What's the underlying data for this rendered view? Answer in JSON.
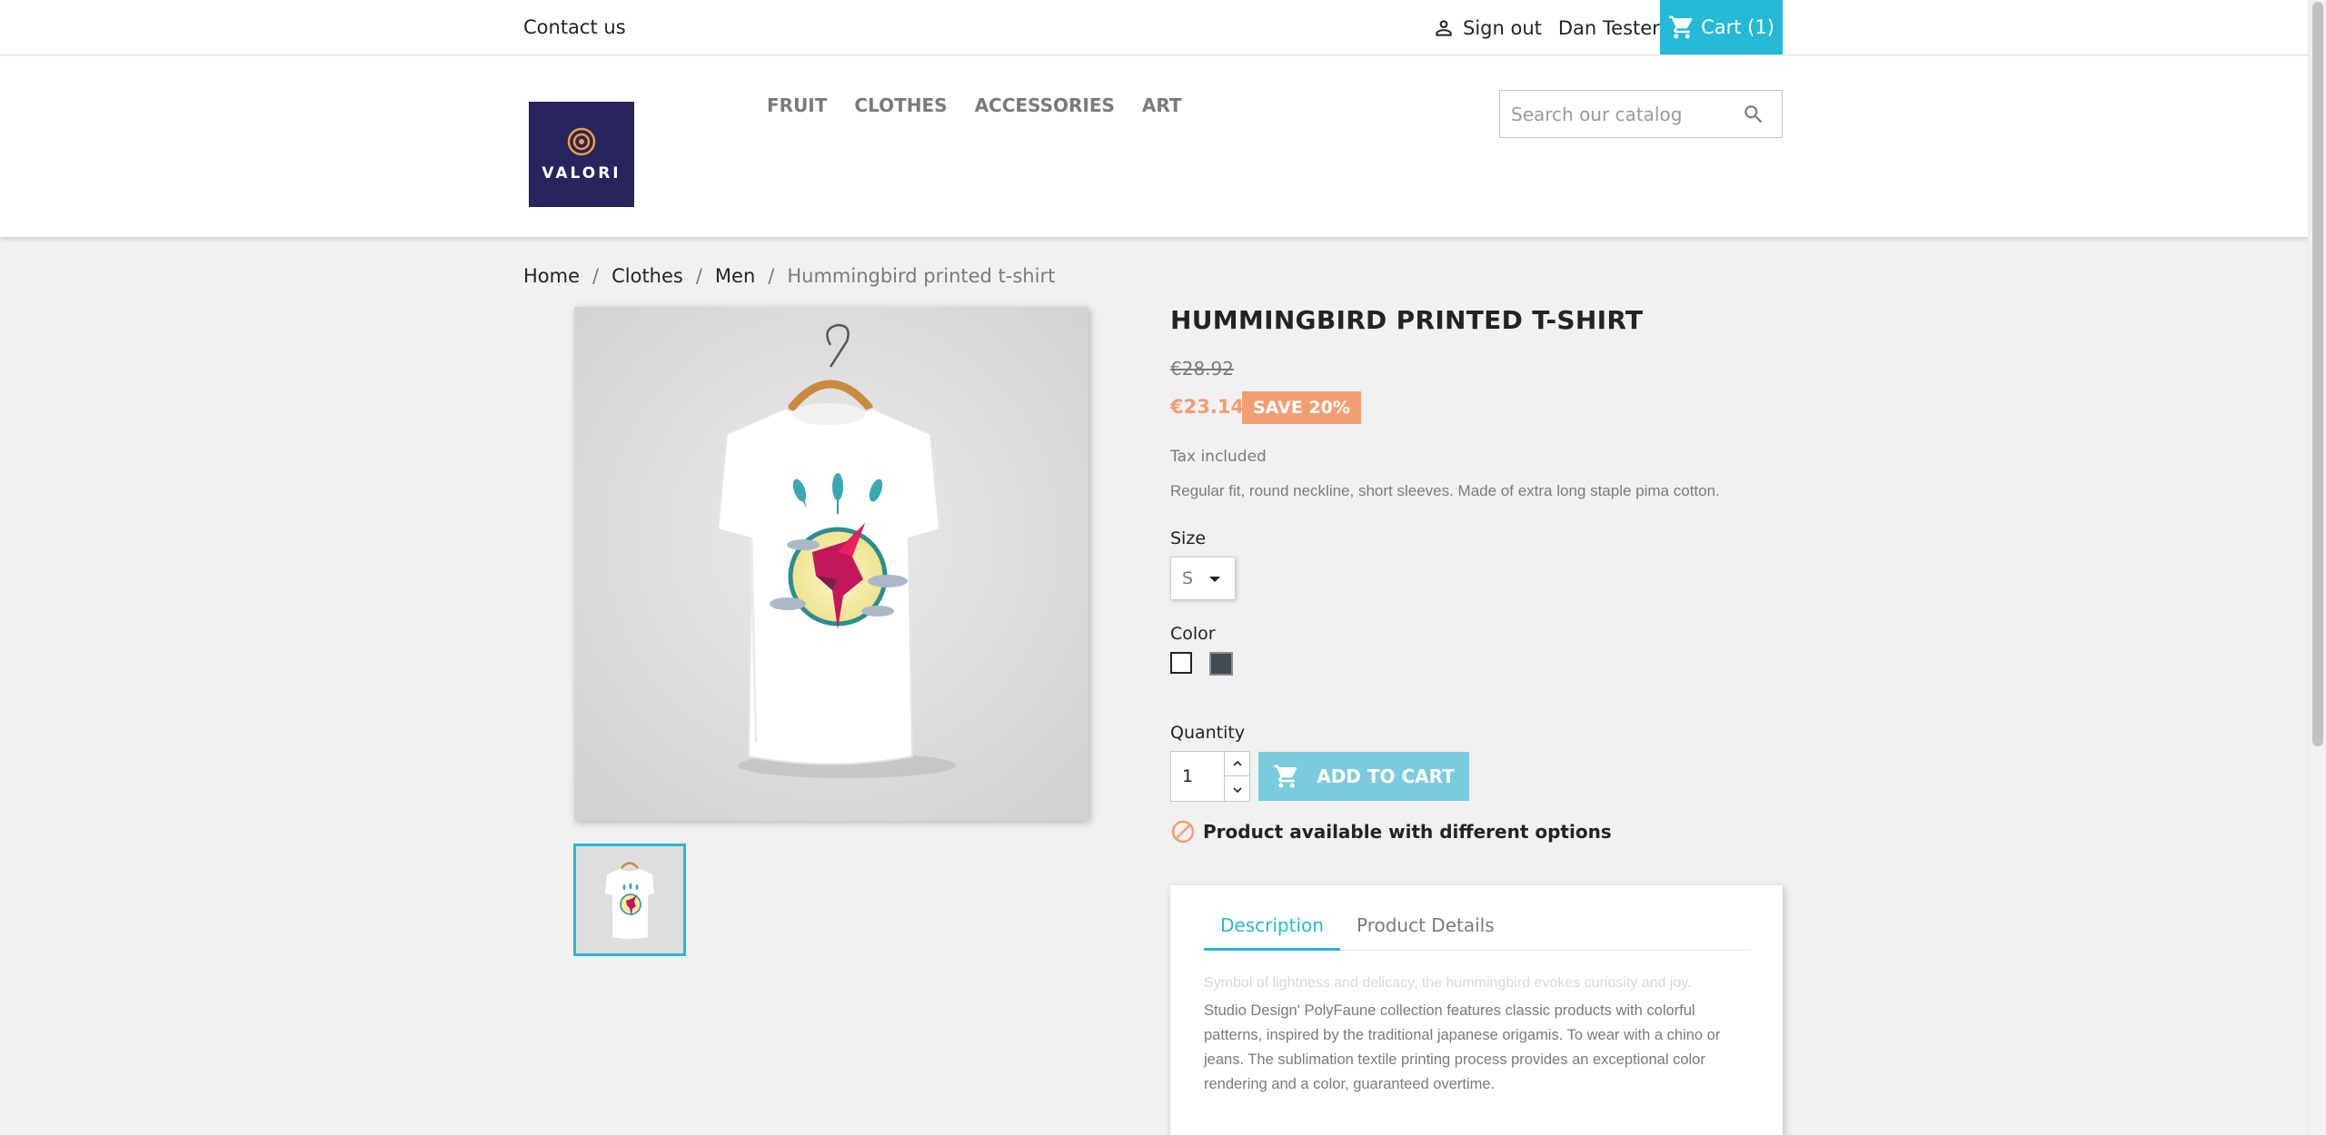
{
  "header": {
    "contact_label": "Contact us",
    "sign_out_label": "Sign out",
    "customer_name": "Dan Tester",
    "cart_label": "Cart (1)"
  },
  "logo": {
    "text": "VALORI"
  },
  "menu": {
    "items": [
      {
        "label": "FRUIT"
      },
      {
        "label": "CLOTHES"
      },
      {
        "label": "ACCESSORIES"
      },
      {
        "label": "ART"
      }
    ]
  },
  "search": {
    "placeholder": "Search our catalog"
  },
  "breadcrumb": {
    "items": [
      "Home",
      "Clothes",
      "Men"
    ],
    "current": "Hummingbird printed t-shirt",
    "separator": "/"
  },
  "product": {
    "title": "HUMMINGBIRD PRINTED T-SHIRT",
    "regular_price": "€28.92",
    "price": "€23.14",
    "discount_label": "SAVE 20%",
    "tax_label": "Tax included",
    "short_description": "Regular fit, round neckline, short sleeves. Made of extra long staple pima cotton.",
    "size_label": "Size",
    "size_value": "S",
    "color_label": "Color",
    "colors": [
      "#ffffff",
      "#434a54"
    ],
    "quantity_label": "Quantity",
    "quantity_value": "1",
    "add_to_cart_label": "ADD TO CART",
    "availability_text": "Product available with different options"
  },
  "tabs": {
    "items": [
      {
        "label": "Description"
      },
      {
        "label": "Product Details"
      }
    ],
    "active": "Description",
    "description_faded": "Symbol of lightness and delicacy, the hummingbird evokes curiosity and joy.",
    "description_text": "Studio Design' PolyFaune collection features classic products with colorful patterns, inspired by the traditional japanese origamis. To wear with a chino or jeans. The sublimation textile printing process provides an exceptional color rendering and a color, guaranteed overtime."
  },
  "icons": {
    "user": "person-icon",
    "cart": "cart-icon",
    "search": "search-icon",
    "availability": "block-icon"
  },
  "colors": {
    "accent": "#24b9d7",
    "price": "#f39d72",
    "logo_bg": "#27245e"
  }
}
